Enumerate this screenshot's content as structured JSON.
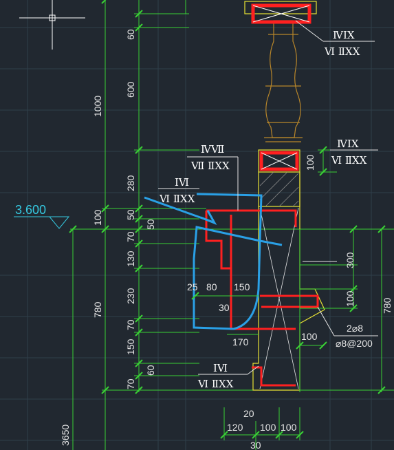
{
  "colors": {
    "background": "#212830",
    "grid": "#2f3f4a",
    "dimension": "#39d135",
    "outline": "#e8e233",
    "rebar": "#ff2020",
    "markup": "#2aa0e6",
    "text": "#e6e6e6",
    "level": "#35c8e0"
  },
  "level_marker": {
    "value": "3.600"
  },
  "left_dimensions": {
    "overall": [
      "1000",
      "780",
      "3650"
    ],
    "detail": [
      "60",
      "600",
      "280",
      "50",
      "70",
      "130",
      "230",
      "70",
      "150",
      "70"
    ],
    "inner": [
      "100",
      "50",
      "60"
    ]
  },
  "right_dimensions": [
    "300",
    "100",
    "780"
  ],
  "bottom_dimensions": [
    "20",
    "120",
    "100",
    "100",
    "30"
  ],
  "section_dimensions": [
    "25",
    "80",
    "150",
    "30",
    "170",
    "100",
    "100"
  ],
  "rebar_labels": [
    "2⌀8",
    "⌀8@200"
  ],
  "callouts": [
    {
      "top": "ⅣⅠⅩ",
      "bottom": "Ⅵ ⅡⅩⅩ"
    },
    {
      "top": "ⅣⅠⅩ",
      "bottom": "Ⅵ ⅡⅩⅩ"
    },
    {
      "top": "ⅣⅦ",
      "bottom": "Ⅶ ⅡⅩⅩ"
    },
    {
      "top": "ⅠⅥ",
      "bottom": "Ⅵ ⅡⅩⅩ"
    },
    {
      "top": "ⅠⅥ",
      "bottom": "Ⅵ ⅡⅩⅩ"
    }
  ]
}
